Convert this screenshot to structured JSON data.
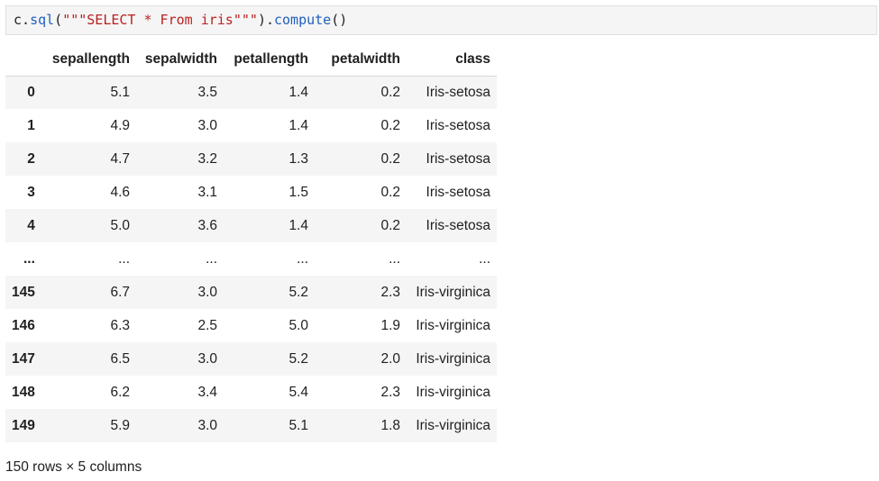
{
  "code_cell": {
    "tokens": [
      {
        "text": "c",
        "kind": "var"
      },
      {
        "text": ".",
        "kind": "punc"
      },
      {
        "text": "sql",
        "kind": "fn"
      },
      {
        "text": "(",
        "kind": "punc"
      },
      {
        "text": "\"\"\"SELECT * From iris\"\"\"",
        "kind": "str"
      },
      {
        "text": ").",
        "kind": "punc"
      },
      {
        "text": "compute",
        "kind": "fn"
      },
      {
        "text": "()",
        "kind": "punc"
      }
    ]
  },
  "table": {
    "columns": [
      "",
      "sepallength",
      "sepalwidth",
      "petallength",
      "petalwidth",
      "class"
    ],
    "rows": [
      {
        "index": "0",
        "cells": [
          "5.1",
          "3.5",
          "1.4",
          "0.2",
          "Iris-setosa"
        ]
      },
      {
        "index": "1",
        "cells": [
          "4.9",
          "3.0",
          "1.4",
          "0.2",
          "Iris-setosa"
        ]
      },
      {
        "index": "2",
        "cells": [
          "4.7",
          "3.2",
          "1.3",
          "0.2",
          "Iris-setosa"
        ]
      },
      {
        "index": "3",
        "cells": [
          "4.6",
          "3.1",
          "1.5",
          "0.2",
          "Iris-setosa"
        ]
      },
      {
        "index": "4",
        "cells": [
          "5.0",
          "3.6",
          "1.4",
          "0.2",
          "Iris-setosa"
        ]
      },
      {
        "index": "...",
        "cells": [
          "...",
          "...",
          "...",
          "...",
          "..."
        ]
      },
      {
        "index": "145",
        "cells": [
          "6.7",
          "3.0",
          "5.2",
          "2.3",
          "Iris-virginica"
        ]
      },
      {
        "index": "146",
        "cells": [
          "6.3",
          "2.5",
          "5.0",
          "1.9",
          "Iris-virginica"
        ]
      },
      {
        "index": "147",
        "cells": [
          "6.5",
          "3.0",
          "5.2",
          "2.0",
          "Iris-virginica"
        ]
      },
      {
        "index": "148",
        "cells": [
          "6.2",
          "3.4",
          "5.4",
          "2.3",
          "Iris-virginica"
        ]
      },
      {
        "index": "149",
        "cells": [
          "5.9",
          "3.0",
          "5.1",
          "1.8",
          "Iris-virginica"
        ]
      }
    ]
  },
  "footer": {
    "shape_text": "150 rows × 5 columns"
  },
  "colors": {
    "string": "#ba2121",
    "function": "#1f5fbf",
    "stripe": "#f5f5f5"
  }
}
